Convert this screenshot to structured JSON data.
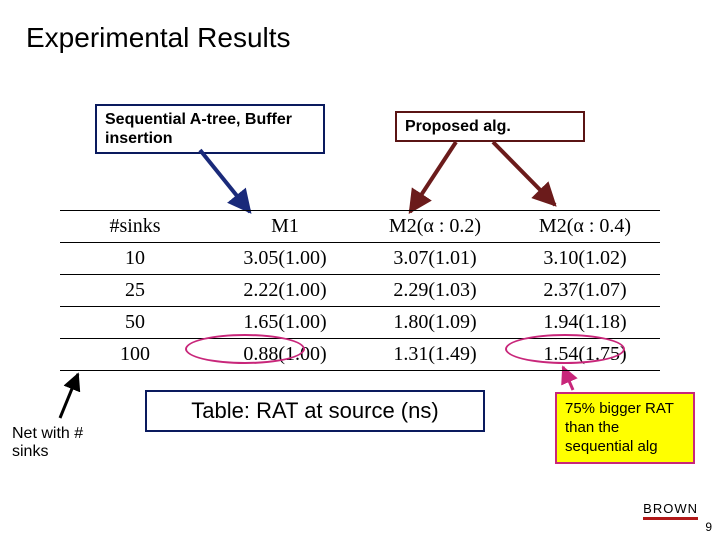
{
  "title": "Experimental Results",
  "labels": {
    "sequential": "Sequential A-tree, Buffer insertion",
    "proposed": "Proposed alg."
  },
  "table": {
    "headers": [
      "#sinks",
      "M1",
      "M2(α : 0.2)",
      "M2(α : 0.4)"
    ],
    "rows": [
      [
        "10",
        "3.05(1.00)",
        "3.07(1.01)",
        "3.10(1.02)"
      ],
      [
        "25",
        "2.22(1.00)",
        "2.29(1.03)",
        "2.37(1.07)"
      ],
      [
        "50",
        "1.65(1.00)",
        "1.80(1.09)",
        "1.94(1.18)"
      ],
      [
        "100",
        "0.88(1.00)",
        "1.31(1.49)",
        "1.54(1.75)"
      ]
    ]
  },
  "caption": "Table: RAT at source (ns)",
  "net_label": "Net with # sinks",
  "summary": "75% bigger RAT than the sequential alg",
  "footer": {
    "brand": "BROWN",
    "page": "9"
  }
}
